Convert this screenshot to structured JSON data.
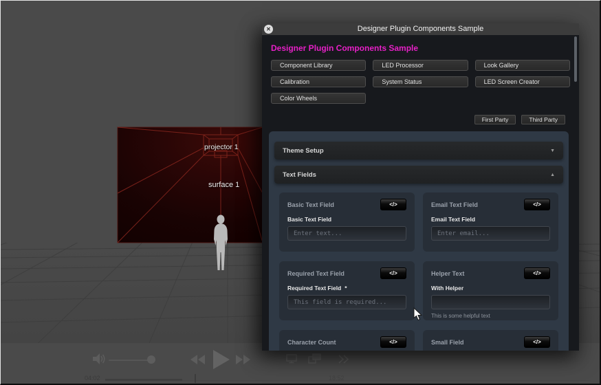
{
  "dialog": {
    "window_title": "Designer Plugin Components Sample",
    "heading": "Designer Plugin Components Sample",
    "close_glyph": "✕",
    "nav_buttons": [
      "Component Library",
      "LED Processor",
      "Look Gallery",
      "Calibration",
      "System Status",
      "LED Screen Creator",
      "Color Wheels"
    ],
    "party_buttons": [
      "First Party",
      "Third Party"
    ],
    "accordions": [
      {
        "label": "Theme Setup",
        "chevron": "▼",
        "state": "collapsed"
      },
      {
        "label": "Text Fields",
        "chevron": "▲",
        "state": "expanded"
      }
    ],
    "code_button_label": "</>",
    "cards": [
      {
        "title": "Basic Text Field",
        "field_label": "Basic Text Field",
        "placeholder": "Enter text...",
        "value": ""
      },
      {
        "title": "Email Text Field",
        "field_label": "Email Text Field",
        "placeholder": "Enter email...",
        "value": ""
      },
      {
        "title": "Required Text Field",
        "field_label": "Required Text Field",
        "required_mark": "*",
        "placeholder": "This field is required...",
        "value": ""
      },
      {
        "title": "Helper Text",
        "field_label": "With Helper",
        "placeholder": "",
        "value": "",
        "helper": "This is some helpful text"
      },
      {
        "title": "Character Count"
      },
      {
        "title": "Small Field"
      }
    ]
  },
  "scene": {
    "projector_label": "projector 1",
    "surface_label": "surface 1"
  },
  "transport": {
    "elapsed": "04:02",
    "cue": "18:52"
  },
  "colors": {
    "accent_pink": "#e620c6",
    "dialog_bg": "#17191d",
    "panel_blue": "#2f3945",
    "viewport_gray": "#4a4a4a",
    "wire_red": "#84251d"
  }
}
